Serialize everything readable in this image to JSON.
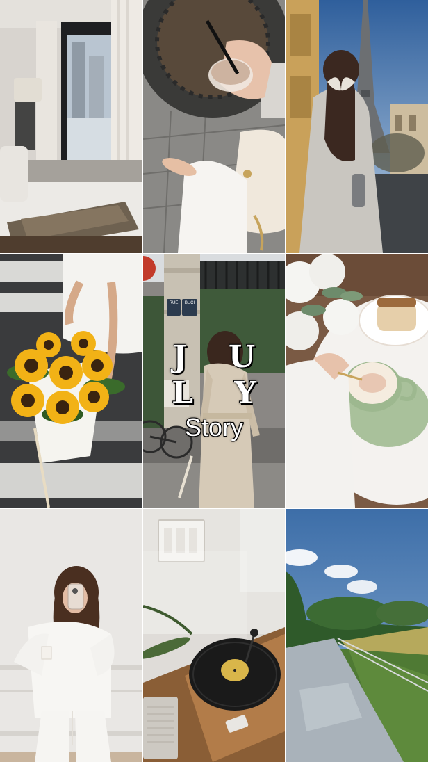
{
  "story": {
    "title": "J U L Y",
    "subtitle": "Story"
  },
  "photos": [
    {
      "subject": "bedroom-window"
    },
    {
      "subject": "iced-coffee-cobblestone"
    },
    {
      "subject": "eiffel-tower-bow"
    },
    {
      "subject": "sunflower-bouquet"
    },
    {
      "subject": "paris-trench-coat"
    },
    {
      "subject": "cappuccino-dessert"
    },
    {
      "subject": "mirror-selfie"
    },
    {
      "subject": "record-player"
    },
    {
      "subject": "park-path"
    }
  ],
  "signs": {
    "street_sign_1": "RUE",
    "street_sign_2": "BUCI"
  },
  "colors": {
    "background": "#ffffff",
    "title": "#ffffff",
    "sunflower": "#f2b216",
    "sky": "#4f7fb8",
    "latte_cup": "#9db88f"
  }
}
